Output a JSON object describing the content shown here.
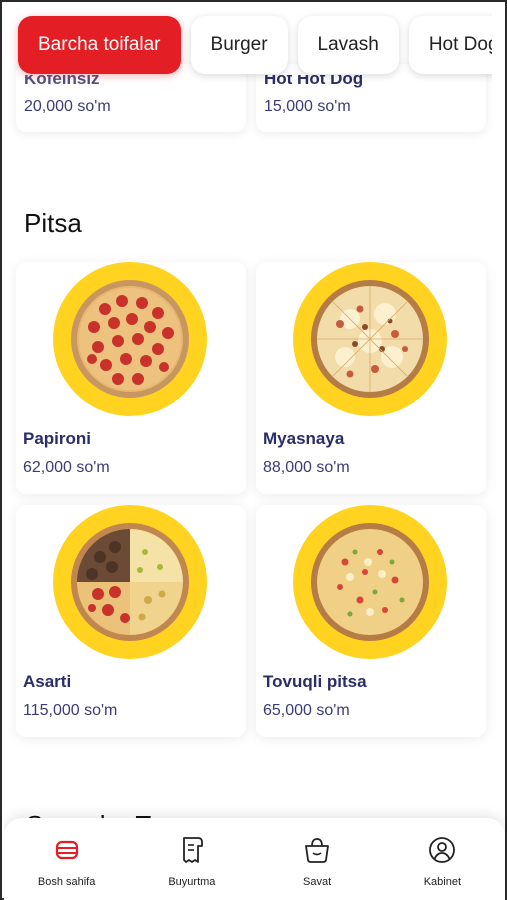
{
  "categories": [
    {
      "label": "Barcha toifalar",
      "active": true
    },
    {
      "label": "Burger",
      "active": false
    },
    {
      "label": "Lavash",
      "active": false
    },
    {
      "label": "Hot Dog",
      "active": false
    }
  ],
  "top_items": [
    {
      "name": "Kofeinsiz",
      "price": "20,000 so'm"
    },
    {
      "name": "Hot Hot Dog",
      "price": "15,000 so'm"
    }
  ],
  "section_title": "Pitsa",
  "products": [
    {
      "name": "Papironi",
      "price": "62,000 so'm",
      "image": "pepperoni-pizza"
    },
    {
      "name": "Myasnaya",
      "price": "88,000 so'm",
      "image": "meat-pizza"
    },
    {
      "name": "Asarti",
      "price": "115,000 so'm",
      "image": "assorti-pizza"
    },
    {
      "name": "Tovuqli pitsa",
      "price": "65,000 so'm",
      "image": "chicken-pizza"
    }
  ],
  "next_section_title": "Sovuqlar Tanr",
  "nav": [
    {
      "label": "Bosh sahifa",
      "icon": "home-icon",
      "active": true
    },
    {
      "label": "Buyurtma",
      "icon": "receipt-icon",
      "active": false
    },
    {
      "label": "Savat",
      "icon": "basket-icon",
      "active": false
    },
    {
      "label": "Kabinet",
      "icon": "user-icon",
      "active": false
    }
  ],
  "colors": {
    "accent": "#e31e24",
    "plate": "#ffd31f",
    "text_dark": "#2b2d6a"
  }
}
